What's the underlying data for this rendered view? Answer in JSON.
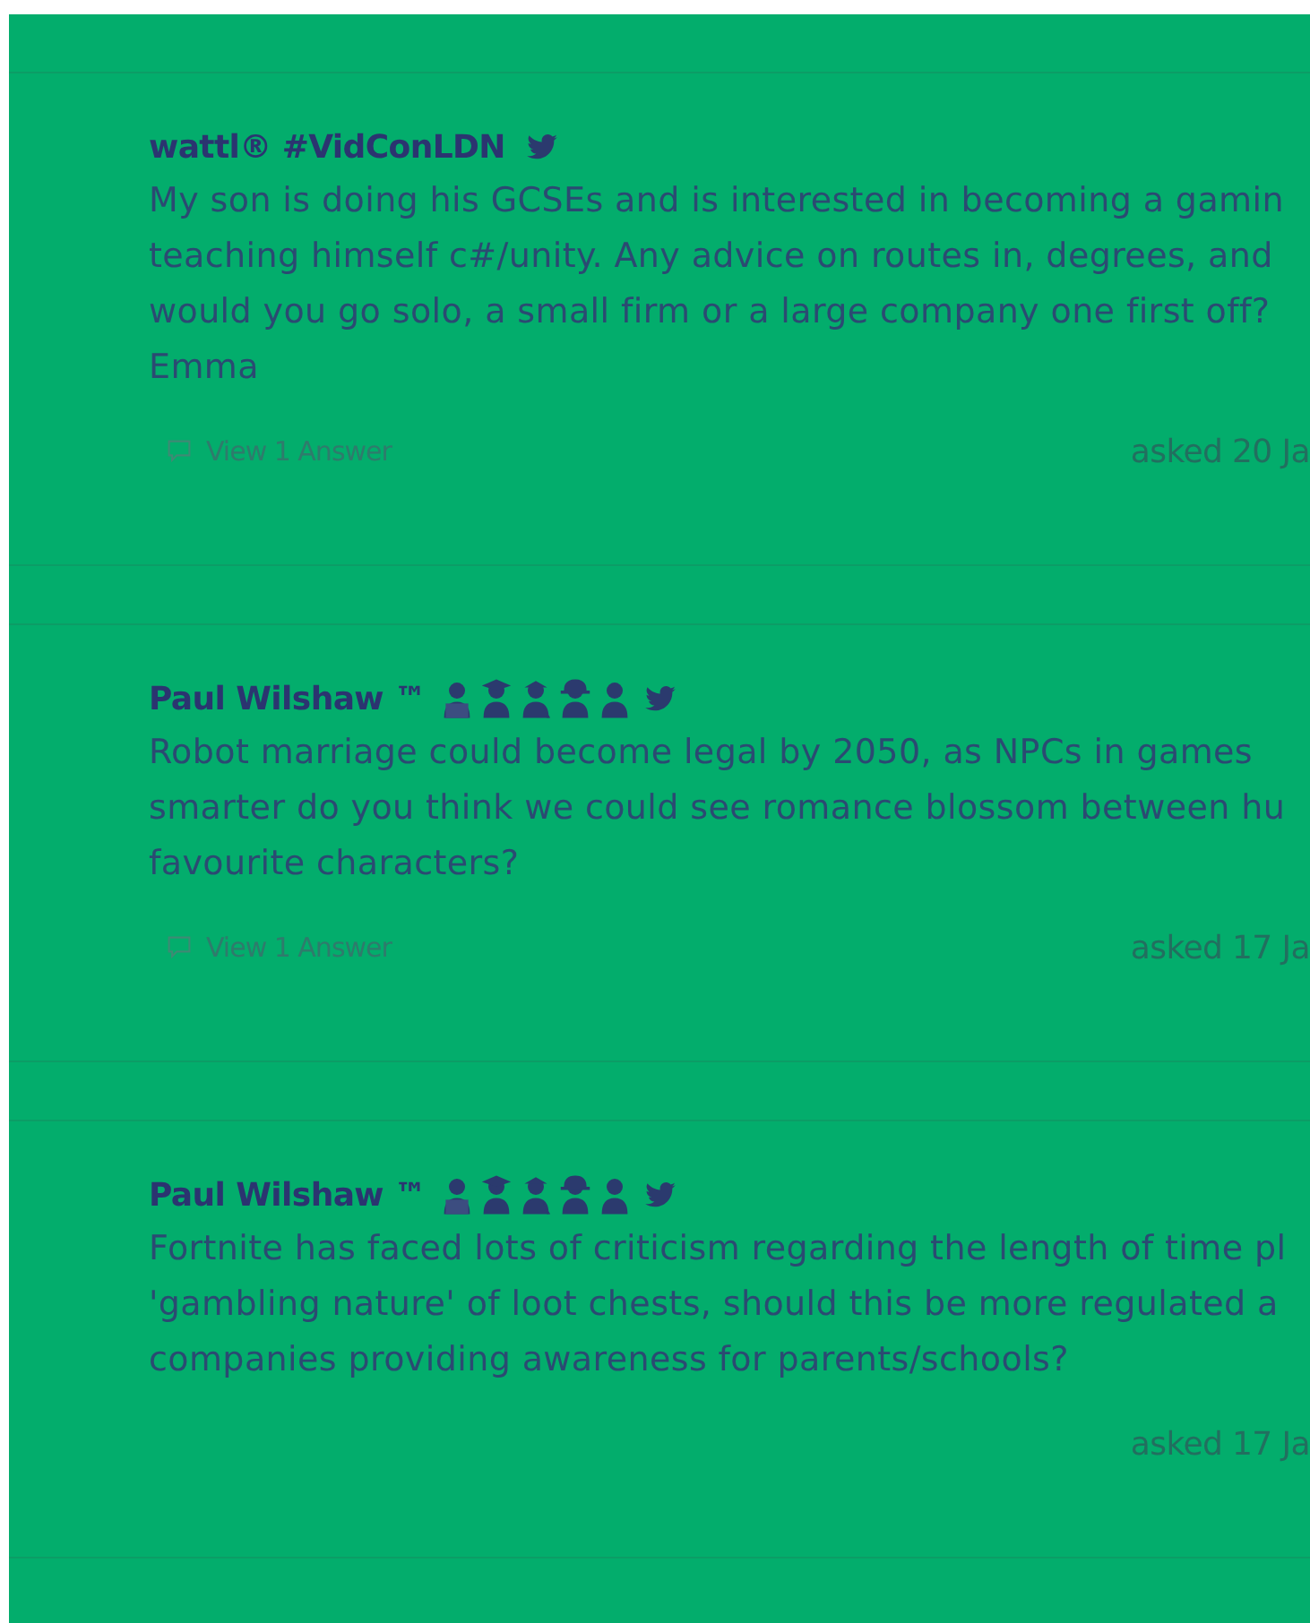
{
  "questions": [
    {
      "author": "wattl® #VidConLDN",
      "lines": [
        "My son is doing his GCSEs and is interested in becoming a gamin",
        "teaching himself c#/unity. Any advice on routes in, degrees, and",
        "would you go solo, a small firm or a large company one first off?",
        "Emma"
      ],
      "answers_link": "View 1 Answer",
      "asked": "asked 20 Ja"
    },
    {
      "author": "Paul Wilshaw ™",
      "badges": [
        {
          "kind": "laptop"
        },
        {
          "kind": "cap"
        },
        {
          "kind": "teacher"
        },
        {
          "kind": "helmet"
        },
        {
          "kind": "plain"
        }
      ],
      "lines": [
        "Robot marriage could become legal by 2050, as NPCs in games",
        "smarter do you think we could see romance blossom between hu",
        "favourite characters?"
      ],
      "answers_link": "View 1 Answer",
      "asked": "asked 17 Ja"
    },
    {
      "author": "Paul Wilshaw ™",
      "badges": [
        {
          "kind": "laptop"
        },
        {
          "kind": "cap"
        },
        {
          "kind": "teacher"
        },
        {
          "kind": "helmet"
        },
        {
          "kind": "plain"
        }
      ],
      "lines": [
        "Fortnite has faced lots of criticism regarding the length of time pl",
        "'gambling nature' of loot chests, should this be more regulated a",
        "companies providing awareness for parents/schools?"
      ],
      "asked": "asked 17 Ja"
    }
  ]
}
